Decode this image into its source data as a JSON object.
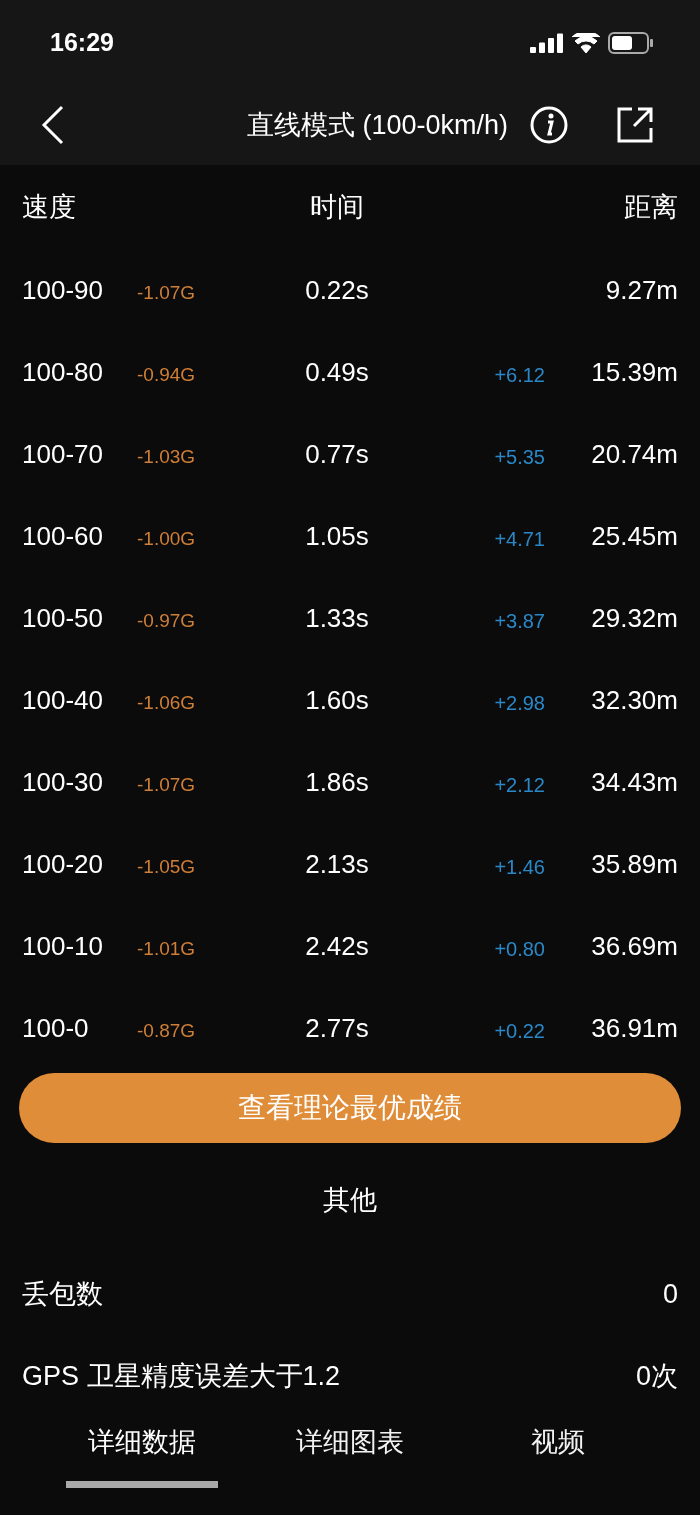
{
  "status_bar": {
    "time": "16:29"
  },
  "nav": {
    "title": "直线模式 (100-0km/h)"
  },
  "table": {
    "columns": [
      "速度",
      "时间",
      "距离"
    ],
    "rows": [
      {
        "speed": "100-90",
        "g": "-1.07G",
        "time": "0.22s",
        "distance": "9.27m"
      },
      {
        "speed": "100-80",
        "g": "-0.94G",
        "time": "0.49s",
        "delta": "+6.12",
        "distance": "15.39m"
      },
      {
        "speed": "100-70",
        "g": "-1.03G",
        "time": "0.77s",
        "delta": "+5.35",
        "distance": "20.74m"
      },
      {
        "speed": "100-60",
        "g": "-1.00G",
        "time": "1.05s",
        "delta": "+4.71",
        "distance": "25.45m"
      },
      {
        "speed": "100-50",
        "g": "-0.97G",
        "time": "1.33s",
        "delta": "+3.87",
        "distance": "29.32m"
      },
      {
        "speed": "100-40",
        "g": "-1.06G",
        "time": "1.60s",
        "delta": "+2.98",
        "distance": "32.30m"
      },
      {
        "speed": "100-30",
        "g": "-1.07G",
        "time": "1.86s",
        "delta": "+2.12",
        "distance": "34.43m"
      },
      {
        "speed": "100-20",
        "g": "-1.05G",
        "time": "2.13s",
        "delta": "+1.46",
        "distance": "35.89m"
      },
      {
        "speed": "100-10",
        "g": "-1.01G",
        "time": "2.42s",
        "delta": "+0.80",
        "distance": "36.69m"
      },
      {
        "speed": "100-0",
        "g": "-0.87G",
        "time": "2.77s",
        "delta": "+0.22",
        "distance": "36.91m"
      }
    ]
  },
  "button": "查看理论最优成绩",
  "other": {
    "title": "其他",
    "items": [
      {
        "label": "丢包数",
        "value": "0"
      },
      {
        "label": "GPS 卫星精度误差大于1.2",
        "value": "0次"
      }
    ]
  },
  "tabs": [
    {
      "label": "详细数据",
      "selected": true
    },
    {
      "label": "详细图表",
      "selected": false
    },
    {
      "label": "视频",
      "selected": false
    }
  ]
}
